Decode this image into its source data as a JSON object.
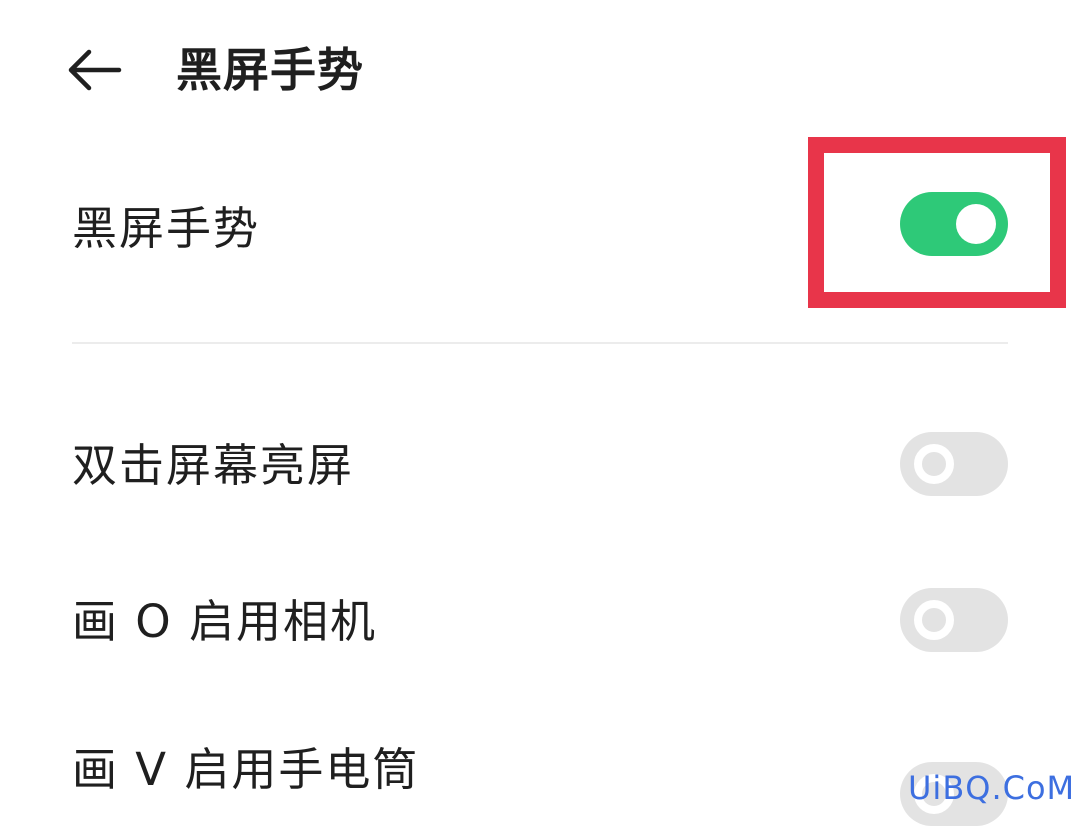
{
  "header": {
    "back_icon": "arrow-left-icon",
    "title": "黑屏手势"
  },
  "main_toggle": {
    "label": "黑屏手势",
    "enabled": true,
    "on_color": "#2ec978"
  },
  "gestures": [
    {
      "label": "双击屏幕亮屏",
      "enabled": false
    },
    {
      "label": "画 O 启用相机",
      "enabled": false
    },
    {
      "label": "画 V 启用手电筒",
      "enabled": false
    }
  ],
  "annotation": {
    "highlight_color": "#e8354a"
  },
  "watermark": "UiBQ.CoM"
}
